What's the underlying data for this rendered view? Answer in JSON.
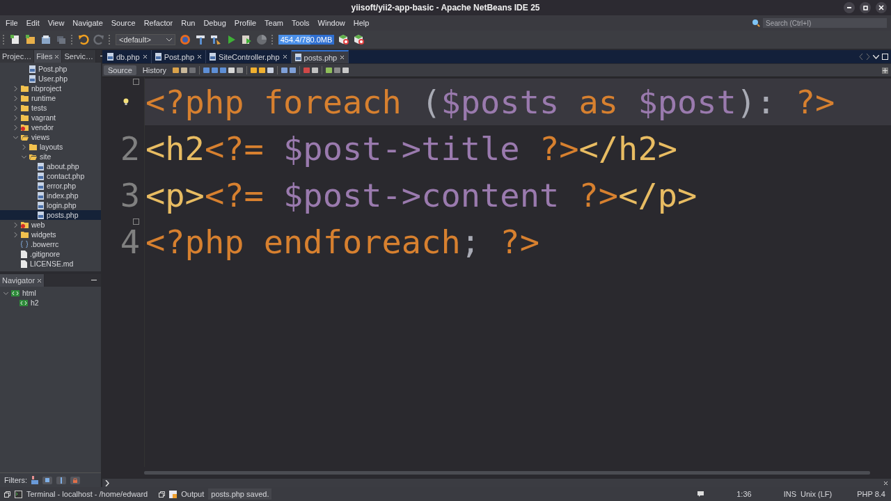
{
  "window": {
    "title": "yiisoft/yii2-app-basic - Apache NetBeans IDE 25"
  },
  "menu": [
    "File",
    "Edit",
    "View",
    "Navigate",
    "Source",
    "Refactor",
    "Run",
    "Debug",
    "Profile",
    "Team",
    "Tools",
    "Window",
    "Help"
  ],
  "search": {
    "placeholder": "Search (Ctrl+I)"
  },
  "toolbar": {
    "configuration": "<default>",
    "memory": {
      "reading": "454.4/780.0MB",
      "level": 0.58
    }
  },
  "project_panel": {
    "tabs": [
      {
        "label": "Projec…",
        "selected": false
      },
      {
        "label": "Files",
        "selected": true
      },
      {
        "label": "Servic…",
        "selected": false
      }
    ],
    "tree": [
      {
        "children": [
          {
            "label": "Post.php",
            "kind": "php",
            "selected": false
          },
          {
            "label": "User.php",
            "kind": "php",
            "selected": false
          }
        ]
      },
      {
        "label": "nbproject",
        "kind": "folder",
        "expanded": false,
        "selected": false
      },
      {
        "label": "runtime",
        "kind": "folder",
        "expanded": false,
        "selected": false
      },
      {
        "label": "tests",
        "kind": "folder",
        "expanded": false,
        "selected": false
      },
      {
        "label": "vagrant",
        "kind": "folder",
        "expanded": false,
        "selected": false
      },
      {
        "label": "vendor",
        "kind": "folder-error",
        "expanded": false,
        "selected": false
      },
      {
        "label": "views",
        "kind": "folder",
        "expanded": true,
        "selected": false,
        "children": [
          {
            "label": "layouts",
            "kind": "folder",
            "expanded": false,
            "selected": false
          },
          {
            "label": "site",
            "kind": "folder",
            "expanded": true,
            "selected": false,
            "children": [
              {
                "label": "about.php",
                "kind": "php",
                "selected": false
              },
              {
                "label": "contact.php",
                "kind": "php",
                "selected": false
              },
              {
                "label": "error.php",
                "kind": "php",
                "selected": false
              },
              {
                "label": "index.php",
                "kind": "php",
                "selected": false
              },
              {
                "label": "login.php",
                "kind": "php",
                "selected": false
              },
              {
                "label": "posts.php",
                "kind": "php",
                "selected": true
              }
            ]
          }
        ]
      },
      {
        "label": "web",
        "kind": "folder-error",
        "expanded": false,
        "selected": false
      },
      {
        "label": "widgets",
        "kind": "folder",
        "expanded": false,
        "selected": false
      },
      {
        "label": ".bowerrc",
        "kind": "config",
        "selected": false
      },
      {
        "label": ".gitignore",
        "kind": "file",
        "selected": false
      },
      {
        "label": "LICENSE.md",
        "kind": "file",
        "selected": false
      }
    ]
  },
  "navigator": {
    "title": "Navigator",
    "tree": [
      {
        "label": "html",
        "expanded": true,
        "children": [
          {
            "label": "h2"
          }
        ]
      }
    ],
    "filters_label": "Filters:"
  },
  "editor_tabs": [
    {
      "label": "db.php",
      "selected": false
    },
    {
      "label": "Post.php",
      "selected": false
    },
    {
      "label": "SiteController.php",
      "selected": false
    },
    {
      "label": "posts.php",
      "selected": true
    }
  ],
  "editor_views": [
    {
      "label": "Source",
      "selected": true
    },
    {
      "label": "History",
      "selected": false
    }
  ],
  "code": [
    {
      "hint": true,
      "fold": true,
      "current": true,
      "tokens": [
        {
          "text": "<?php foreach ",
          "kind": "php"
        },
        {
          "text": "(",
          "kind": "plain"
        },
        {
          "text": "$posts",
          "kind": "var"
        },
        {
          "text": " as ",
          "kind": "php"
        },
        {
          "text": "$post",
          "kind": "var"
        },
        {
          "text": "): ",
          "kind": "plain"
        },
        {
          "text": "?>",
          "kind": "php"
        }
      ]
    },
    {
      "number": "2",
      "hint": false,
      "fold": false,
      "current": false,
      "tokens": [
        {
          "text": "<h2",
          "kind": "tag"
        },
        {
          "text": "<?=",
          "kind": "php"
        },
        {
          "text": " $post->title ",
          "kind": "var"
        },
        {
          "text": "?>",
          "kind": "php"
        },
        {
          "text": "</h2>",
          "kind": "tag"
        }
      ]
    },
    {
      "number": "3",
      "hint": false,
      "fold": false,
      "current": false,
      "tokens": [
        {
          "text": "<p>",
          "kind": "tag"
        },
        {
          "text": "<?=",
          "kind": "php"
        },
        {
          "text": " $post->content ",
          "kind": "var"
        },
        {
          "text": "?>",
          "kind": "php"
        },
        {
          "text": "</p>",
          "kind": "tag"
        }
      ]
    },
    {
      "number": "4",
      "hint": false,
      "fold": true,
      "current": false,
      "tokens": [
        {
          "text": "<?php endforeach",
          "kind": "php"
        },
        {
          "text": ";",
          "kind": "plain"
        },
        {
          "text": " ?>",
          "kind": "php"
        }
      ]
    }
  ],
  "status_bar": {
    "terminal": "Terminal - localhost - /home/edward",
    "output": "Output",
    "message": "posts.php saved.",
    "position": "1:36",
    "mode": "INS",
    "line_endings": "Unix (LF)",
    "language": "PHP 8.4"
  }
}
